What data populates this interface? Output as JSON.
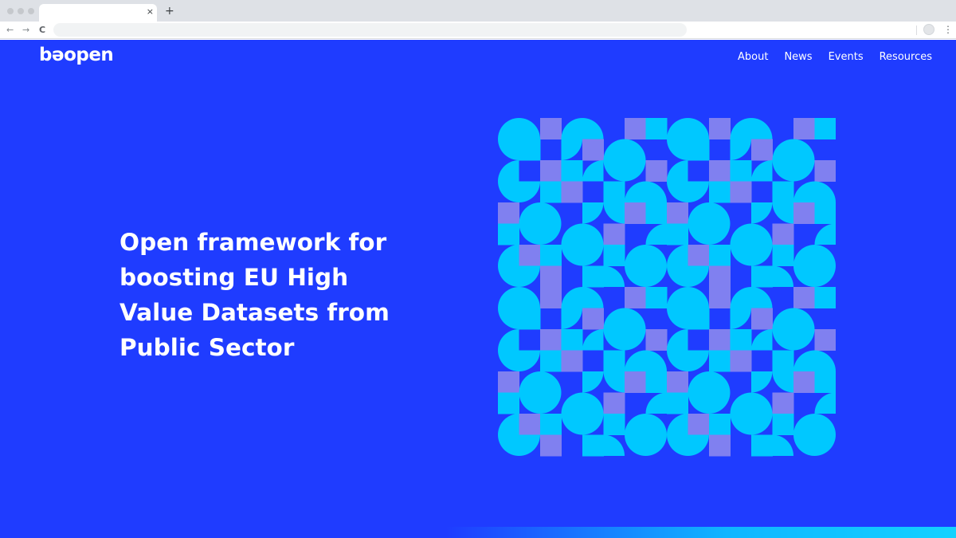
{
  "browser": {
    "tab_close": "×",
    "new_tab": "+",
    "back": "←",
    "forward": "→",
    "reload": "C",
    "menu": "⋮"
  },
  "site": {
    "logo": "bəopen",
    "nav": [
      {
        "label": "About"
      },
      {
        "label": "News"
      },
      {
        "label": "Events"
      },
      {
        "label": "Resources"
      }
    ],
    "hero": {
      "headline": "Open framework for boosting EU High Value Datasets from Public Sector"
    }
  },
  "colors": {
    "background": "#1f3cff",
    "cyan": "#00c8ff",
    "lavender": "#8080f0",
    "text": "#ffffff"
  },
  "icons": [
    "close-icon",
    "plus-icon",
    "back-arrow-icon",
    "forward-arrow-icon",
    "reload-icon",
    "profile-icon",
    "kebab-menu-icon"
  ]
}
